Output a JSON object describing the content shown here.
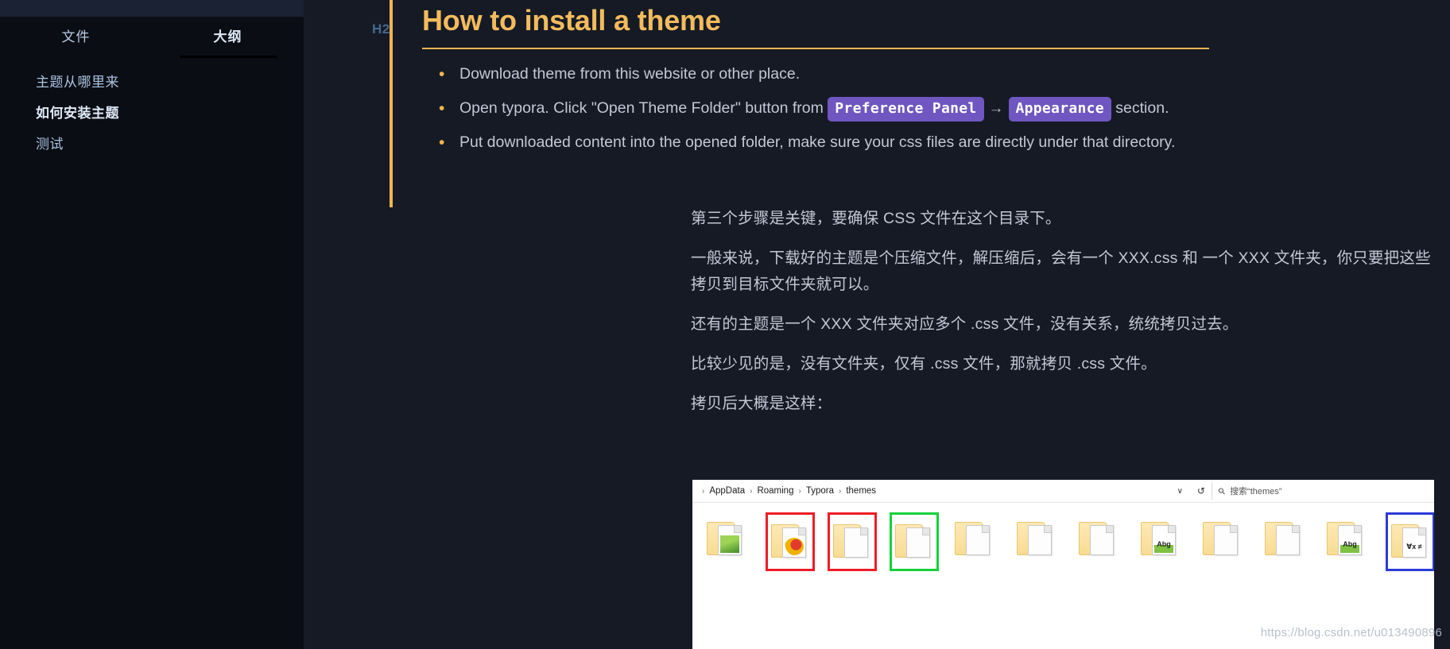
{
  "sidebar": {
    "tabs": [
      {
        "label": "文件",
        "active": false
      },
      {
        "label": "大纲",
        "active": true
      }
    ],
    "outline": [
      {
        "label": "主题从哪里来",
        "current": false
      },
      {
        "label": "如何安装主题",
        "current": true
      },
      {
        "label": "测试",
        "current": false
      }
    ]
  },
  "document": {
    "heading": {
      "marker": "H2",
      "title": "How to install a theme"
    },
    "bullets": {
      "item1": "Download theme from this website or other place.",
      "item2_pre": "Open typora. Click \"Open Theme Folder\" button from",
      "item2_code1": "Preference Panel",
      "item2_arrow": "→",
      "item2_code2": "Appearance",
      "item2_post": "section.",
      "item3": "Put downloaded content into the opened folder, make sure your css files are directly under that directory."
    },
    "paragraphs": [
      "第三个步骤是关键，要确保 CSS 文件在这个目录下。",
      "一般来说，下载好的主题是个压缩文件，解压缩后，会有一个 XXX.css 和 一个 XXX 文件夹，你只要把这些拷贝到目标文件夹就可以。",
      "还有的主题是一个 XXX 文件夹对应多个 .css 文件，没有关系，统统拷贝过去。",
      "比较少见的是，没有文件夹，仅有 .css 文件，那就拷贝 .css 文件。",
      "拷贝后大概是这样："
    ]
  },
  "explorer": {
    "breadcrumb": [
      "AppData",
      "Roaming",
      "Typora",
      "themes"
    ],
    "separator": "›",
    "caret": "∨",
    "refresh": "↺",
    "search_placeholder": "搜索“themes”",
    "folders": [
      {
        "art": "art-leaf",
        "highlight": "none",
        "label": ""
      },
      {
        "art": "art-swirl",
        "highlight": "red",
        "label": ""
      },
      {
        "art": "art-plain",
        "highlight": "red",
        "label": ""
      },
      {
        "art": "art-plain",
        "highlight": "green",
        "label": ""
      },
      {
        "art": "art-plain",
        "highlight": "none",
        "label": ""
      },
      {
        "art": "art-plain",
        "highlight": "none",
        "label": ""
      },
      {
        "art": "art-plain",
        "highlight": "none",
        "label": ""
      },
      {
        "art": "art-abg",
        "highlight": "none",
        "label": "Abg"
      },
      {
        "art": "art-plain",
        "highlight": "none",
        "label": ""
      },
      {
        "art": "art-plain",
        "highlight": "none",
        "label": ""
      },
      {
        "art": "art-abg",
        "highlight": "none",
        "label": "Abg"
      },
      {
        "art": "art-math",
        "highlight": "blue",
        "label": "∀x ≠"
      }
    ]
  },
  "watermark": {
    "text": "https://blog.csdn.net/u013490896"
  },
  "colors": {
    "sidebar_bg": "#0b0d14",
    "main_bg": "#151a25",
    "accent_orange": "#f3bb5c",
    "code_badge": "#6f56c0",
    "body_text": "#c2c9d4",
    "sidebar_text": "#a9c3e0"
  }
}
